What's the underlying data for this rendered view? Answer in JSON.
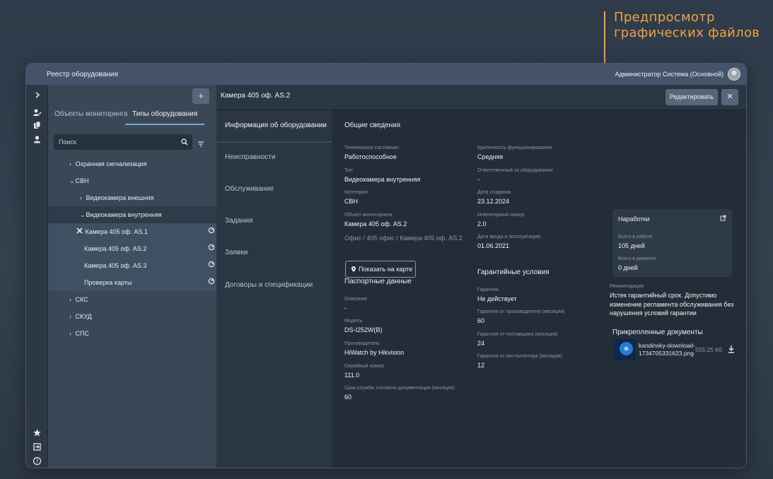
{
  "annotation": {
    "line1": "Предпросмотр",
    "line2": "графических файлов",
    "color": "#f2a143"
  },
  "app": {
    "title": "Реестр оборудования",
    "user": "Администратор Система (Основной)"
  },
  "rail_icons": [
    "chevron-right-icon",
    "user-edit-icon",
    "documents-icon",
    "person-icon",
    "star-icon",
    "logout-icon",
    "help-icon"
  ],
  "left": {
    "add_label": "+",
    "tabs": [
      {
        "label": "Объекты мониторинга",
        "active": false
      },
      {
        "label": "Типы оборудования",
        "active": true
      }
    ],
    "search_placeholder": "Поиск",
    "tree": [
      {
        "label": "Охранная сигнализация",
        "arrow": "›"
      },
      {
        "label": "СВН",
        "arrow": "⌄"
      },
      {
        "label": "Видеокамера внешняя",
        "arrow": "›"
      },
      {
        "label": "Видеокамера внутренняя",
        "arrow": "⌄"
      },
      {
        "label": "Камера 405 оф. AS.1"
      },
      {
        "label": "Камера 405 оф. AS.2"
      },
      {
        "label": "Камера 405 оф. AS.3"
      },
      {
        "label": "Проверка карты"
      },
      {
        "label": "СКС",
        "arrow": "›"
      },
      {
        "label": "СКУД",
        "arrow": "›"
      },
      {
        "label": "СПС",
        "arrow": "›"
      }
    ]
  },
  "header": {
    "name": "Камера 405 оф. AS.2",
    "edit_label": "Редактировать",
    "close_label": "✕"
  },
  "menu": [
    {
      "label": "Информация об оборудовании",
      "active": true
    },
    {
      "label": "Неисправности"
    },
    {
      "label": "Обслуживание"
    },
    {
      "label": "Задания"
    },
    {
      "label": "Заявки"
    },
    {
      "label": "Договоры и спецификации"
    }
  ],
  "general": {
    "title": "Общие сведения",
    "tech_state_label": "Техническое состояние:",
    "tech_state": "Работоспособное",
    "type_label": "Тип",
    "type": "Видеокамера внутренняя",
    "category_label": "Категория",
    "category": "СВН",
    "object_label": "Объект мониторинга",
    "object": "Камера 405 оф. AS.2",
    "path": "Офис / 405 офис / Камера 405 оф. AS.2",
    "map_button": "Показать на карте",
    "criticality_label": "Критичность функционирования",
    "criticality": "Средняя",
    "responsible_label": "Ответственный за оборудование",
    "responsible": "-",
    "created_label": "Дата создания",
    "created": "23.12.2024",
    "inventory_label": "Инвентарный номер",
    "inventory": "2.0",
    "commissioned_label": "Дата ввода в эксплуатацию",
    "commissioned": "01.06.2021"
  },
  "passport": {
    "title": "Паспортные данные",
    "description_label": "Описание",
    "description": "-",
    "model_label": "Модель",
    "model": "DS-I252W(B)",
    "maker_label": "Производитель",
    "maker": "HiWatch by Hikvision",
    "serial_label": "Серийный номер",
    "serial": "111.0",
    "service_life_label": "Срок службы согласно документации (месяцев)",
    "service_life": "60"
  },
  "warranty": {
    "title": "Гарантийные условия",
    "guarantee_label": "Гарантия",
    "guarantee": "Не действует",
    "manufacturer_label": "Гарантия от производителя (месяцев)",
    "manufacturer": "60",
    "supplier_label": "Гарантия от поставщика (месяцев)",
    "supplier": "24",
    "installer_label": "Гарантия от инсталлятора (месяцев)",
    "installer": "12"
  },
  "uptime": {
    "title": "Наработки",
    "in_work_label": "Всего в работе",
    "in_work": "105 дней",
    "in_repair_label": "Всего в ремонте",
    "in_repair": "0 дней"
  },
  "recommendation": {
    "label": "Рекомендация:",
    "line1": "Истек гарантийный срок. Допустимо",
    "line2": "изменение регламента обслуживания без",
    "line3": "нарушения условий гарантии"
  },
  "documents": {
    "title": "Прикрепленные документы",
    "file_line1": "kandinsky-download-",
    "file_line2": "1734705331623.png",
    "size": "555.25 Кб"
  }
}
